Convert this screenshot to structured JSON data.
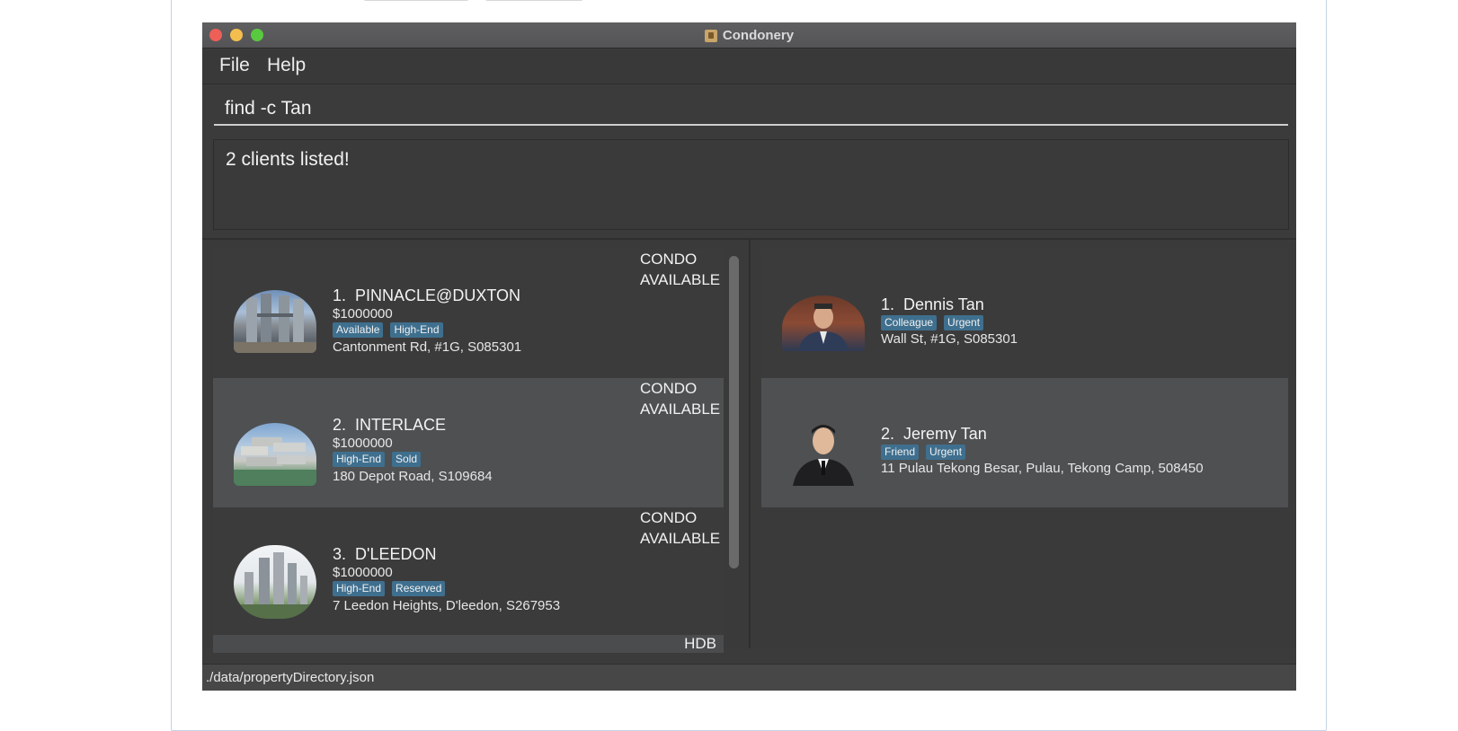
{
  "window": {
    "title": "Condonery"
  },
  "menu": {
    "file": "File",
    "help": "Help"
  },
  "command": {
    "value": "find -c Tan"
  },
  "result": {
    "message": "2 clients listed!"
  },
  "properties": [
    {
      "index": "1.",
      "name": "PINNACLE@DUXTON",
      "price": "$1000000",
      "tags": [
        "Available",
        "High-End"
      ],
      "address": "Cantonment Rd, #1G, S085301",
      "type": "CONDO",
      "status": "AVAILABLE"
    },
    {
      "index": "2.",
      "name": "INTERLACE",
      "price": "$1000000",
      "tags": [
        "High-End",
        "Sold"
      ],
      "address": "180 Depot Road, S109684",
      "type": "CONDO",
      "status": "AVAILABLE"
    },
    {
      "index": "3.",
      "name": "D'LEEDON",
      "price": "$1000000",
      "tags": [
        "High-End",
        "Reserved"
      ],
      "address": "7 Leedon Heights, D'leedon, S267953",
      "type": "CONDO",
      "status": "AVAILABLE"
    },
    {
      "type": "HDB"
    }
  ],
  "clients": [
    {
      "index": "1.",
      "name": "Dennis Tan",
      "tags": [
        "Colleague",
        "Urgent"
      ],
      "address": "Wall St, #1G, S085301"
    },
    {
      "index": "2.",
      "name": "Jeremy Tan",
      "tags": [
        "Friend",
        "Urgent"
      ],
      "address": "11 Pulau Tekong Besar, Pulau, Tekong Camp, 508450"
    }
  ],
  "status": {
    "path": "./data/propertyDirectory.json"
  }
}
